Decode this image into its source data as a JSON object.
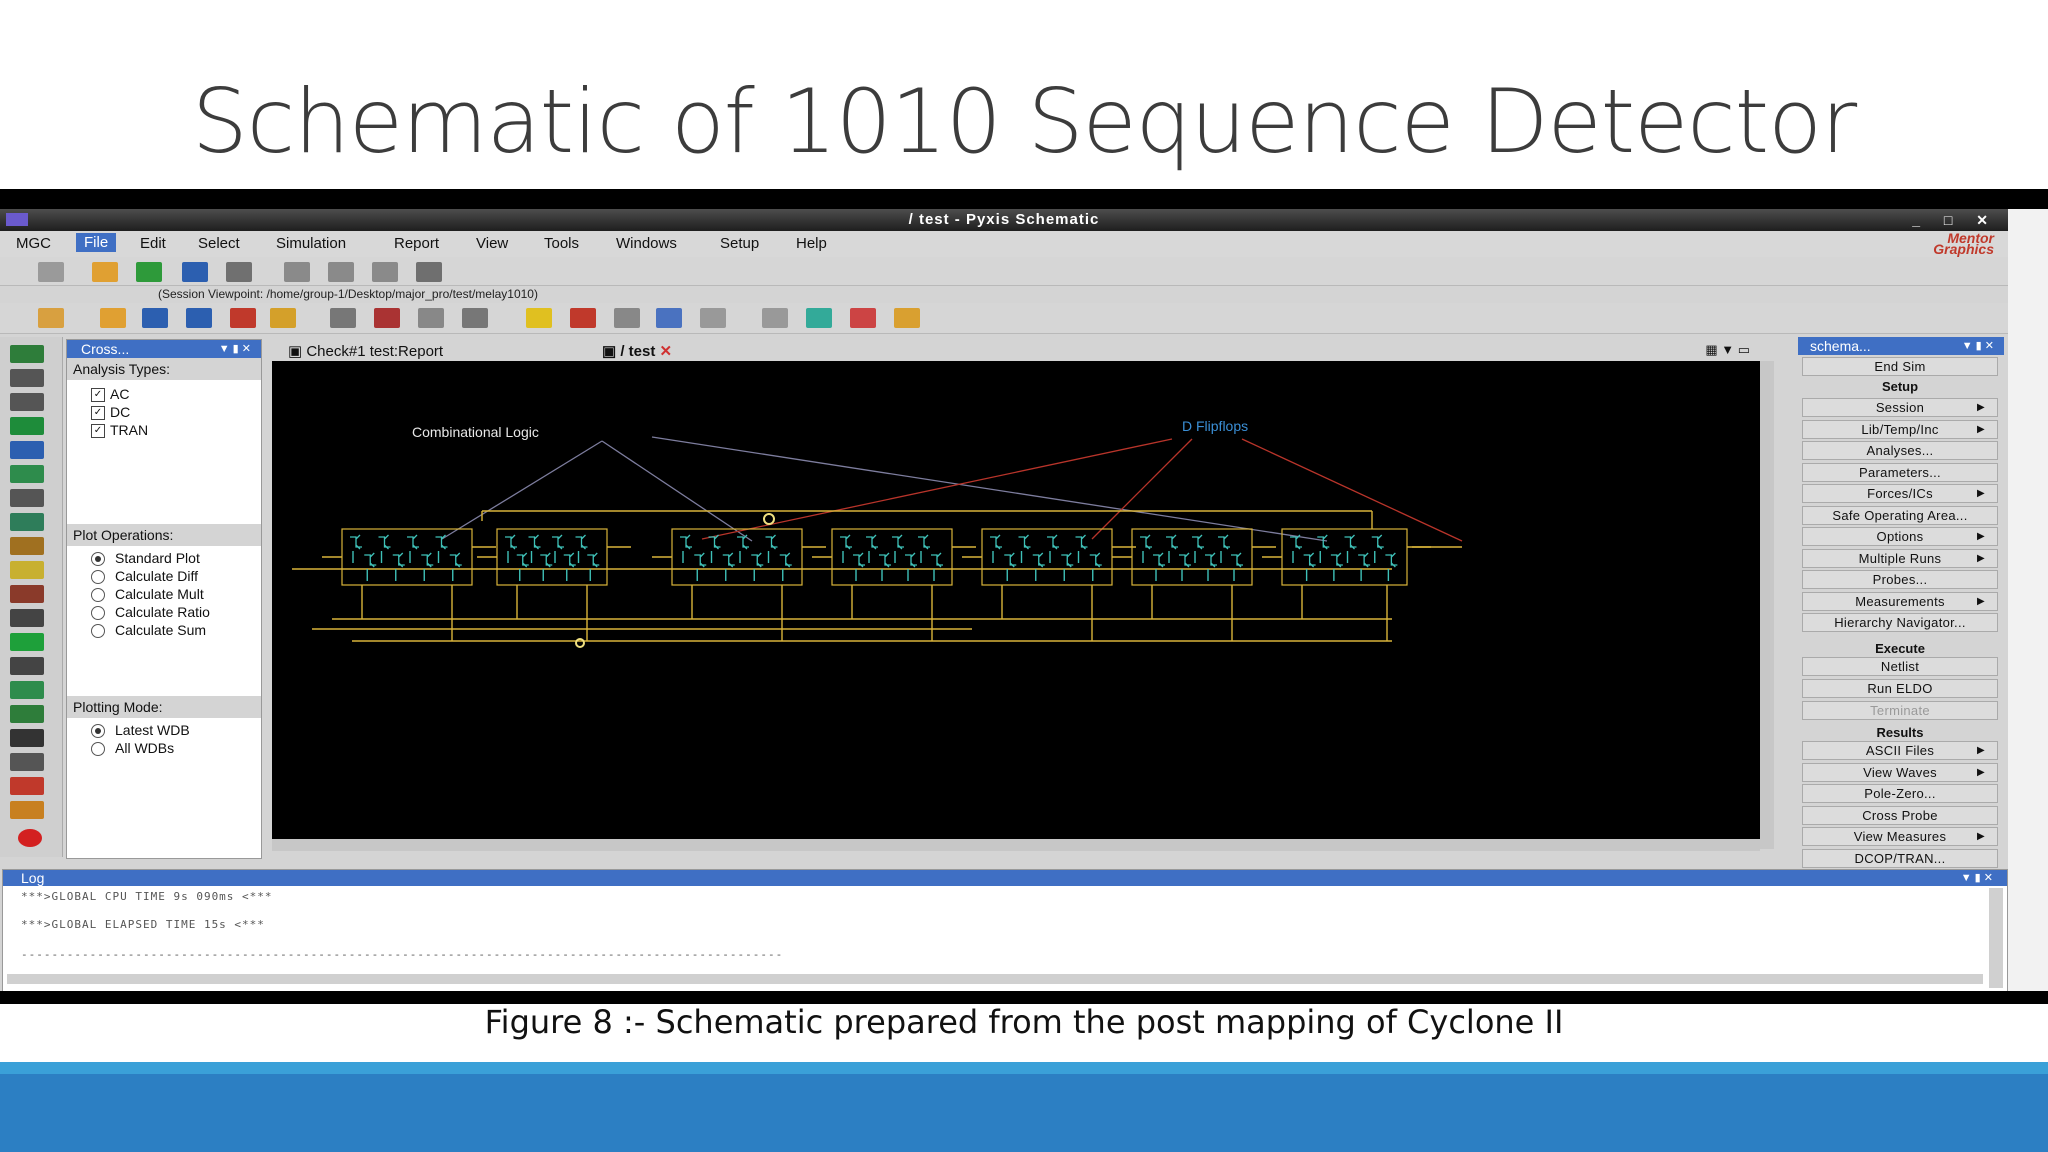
{
  "slide": {
    "title": "Schematic of 1010 Sequence Detector",
    "caption": "Figure 8 :- Schematic prepared from the post mapping of Cyclone II"
  },
  "window": {
    "title": "/  test - Pyxis Schematic",
    "controls": "_ □ ✕",
    "brand_line1": "Mentor",
    "brand_line2": "Graphics"
  },
  "menu": [
    "MGC",
    "File",
    "Edit",
    "Select",
    "Simulation",
    "Report",
    "View",
    "Tools",
    "Windows",
    "Setup",
    "Help"
  ],
  "session_path": "(Session Viewpoint: /home/group-1/Desktop/major_pro/test/melay1010)",
  "left_panel": {
    "header": "Cross...",
    "analysis_title": "Analysis Types:",
    "analysis_types": [
      "AC",
      "DC",
      "TRAN"
    ],
    "plot_title": "Plot Operations:",
    "plot_ops": [
      "Standard Plot",
      "Calculate Diff",
      "Calculate Mult",
      "Calculate Ratio",
      "Calculate Sum"
    ],
    "plot_selected": "Standard Plot",
    "mode_title": "Plotting Mode:",
    "modes": [
      "Latest WDB",
      "All WDBs"
    ],
    "mode_selected": "Latest WDB"
  },
  "doc_tabs": [
    "Check#1  test:Report",
    "/ test"
  ],
  "canvas": {
    "label_combinational": "Combinational Logic",
    "label_flipflops": "D Flipflops"
  },
  "right_panel": {
    "header": "schema...",
    "end_sim": "End Sim",
    "setup_title": "Setup",
    "setup_items": [
      {
        "label": "Session",
        "arrow": true
      },
      {
        "label": "Lib/Temp/Inc",
        "arrow": true
      },
      {
        "label": "Analyses...",
        "arrow": false
      },
      {
        "label": "Parameters...",
        "arrow": false
      },
      {
        "label": "Forces/ICs",
        "arrow": true
      },
      {
        "label": "Safe Operating Area...",
        "arrow": false
      },
      {
        "label": "Options",
        "arrow": true
      },
      {
        "label": "Multiple Runs",
        "arrow": true
      },
      {
        "label": "Probes...",
        "arrow": false
      },
      {
        "label": "Measurements",
        "arrow": true
      },
      {
        "label": "Hierarchy Navigator...",
        "arrow": false
      }
    ],
    "execute_title": "Execute",
    "execute_items": [
      "Netlist",
      "Run ELDO",
      "Terminate"
    ],
    "results_title": "Results",
    "results_items": [
      {
        "label": "ASCII Files",
        "arrow": true
      },
      {
        "label": "View Waves",
        "arrow": true
      },
      {
        "label": "Pole-Zero...",
        "arrow": false
      },
      {
        "label": "Cross Probe",
        "arrow": false
      },
      {
        "label": "View Measures",
        "arrow": true
      },
      {
        "label": "DCOP/TRAN...",
        "arrow": false
      }
    ]
  },
  "log": {
    "header": "Log",
    "lines": [
      "***>GLOBAL CPU TIME 9s 090ms <***",
      "***>GLOBAL ELAPSED TIME 15s <***",
      "----------------------------------------------------------------------------------------------------"
    ]
  },
  "colors": {
    "accent": "#3f6fc4",
    "circuit_wire": "#d9b43a",
    "transistor": "#3fc1b8",
    "combo_line": "#7d7d9e",
    "ff_line": "#b8342a",
    "ff_label": "#3b8fd6",
    "band_light": "#3aa0d8",
    "band_dark": "#2c7fc3"
  }
}
